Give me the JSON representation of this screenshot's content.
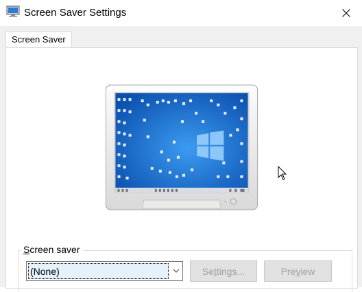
{
  "window": {
    "title": "Screen Saver Settings"
  },
  "tabs": [
    {
      "label": "Screen Saver"
    }
  ],
  "screen_saver_group": {
    "label_prefix": "S",
    "label_rest": "creen saver",
    "selected": "(None)",
    "settings_prefix": "Se",
    "settings_underlined": "t",
    "settings_rest": "tings...",
    "preview_prefix": "Pre",
    "preview_underlined": "v",
    "preview_rest": "iew"
  },
  "colors": {
    "desktop_blue": "#1565c8",
    "accent": "#0078d7"
  }
}
